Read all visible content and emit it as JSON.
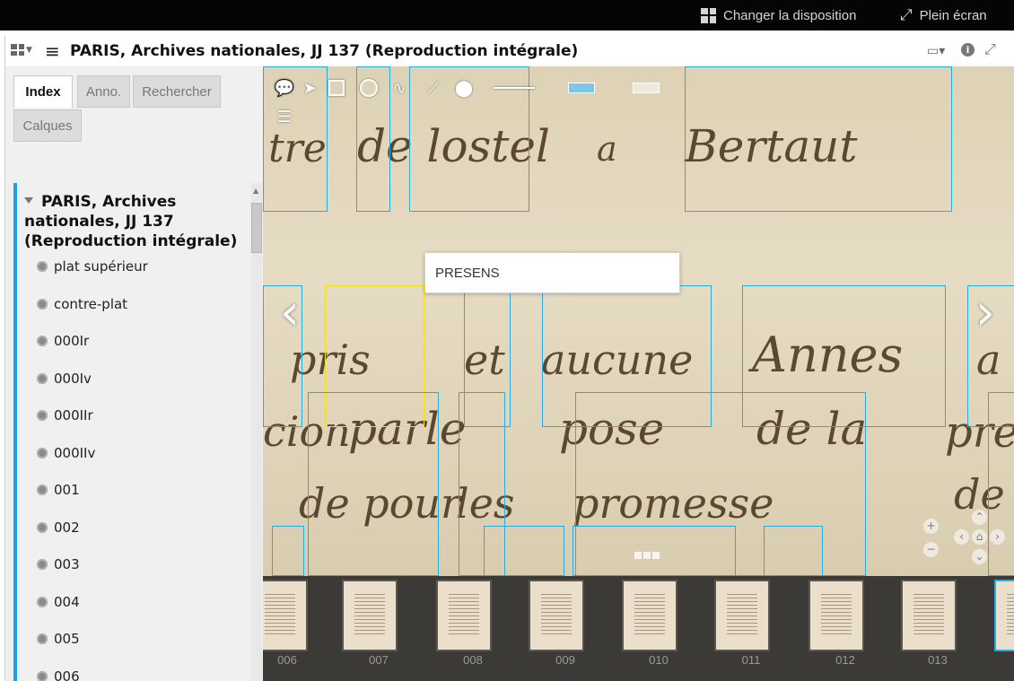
{
  "topbar": {
    "layout_label": "Changer la disposition",
    "fullscreen_label": "Plein écran"
  },
  "window": {
    "title": "PARIS, Archives nationales, JJ 137 (Reproduction intégrale)"
  },
  "sidebar": {
    "tabs": [
      {
        "label": "Index",
        "active": true
      },
      {
        "label": "Anno.",
        "active": false
      },
      {
        "label": "Rechercher",
        "active": false
      },
      {
        "label": "Calques",
        "active": false
      }
    ],
    "tree_root": "PARIS, Archives nationales, JJ 137 (Reproduction intégrale)",
    "items": [
      "plat supérieur",
      "contre-plat",
      "000Ir",
      "000Iv",
      "000IIr",
      "000IIv",
      "001",
      "002",
      "003",
      "004",
      "005",
      "006"
    ]
  },
  "viewer": {
    "tooltip_text": "PRESENS",
    "manuscript_words": [
      "tre",
      "de lostel",
      "a",
      "Bertaut",
      "pris",
      "et",
      "aucune",
      "Annes",
      "a",
      "cion",
      "parle",
      "pose",
      "de la",
      "pre",
      "de pour",
      "les",
      "promesse",
      "de la"
    ],
    "toolbar_icons": [
      "comment-icon",
      "pointer-icon",
      "rectangle-icon",
      "ellipse-icon",
      "freehand-icon",
      "polyline-icon",
      "pin-icon",
      "line-style-icon",
      "stroke-color-icon",
      "fill-color-icon",
      "settings-sliders-icon"
    ],
    "accent_color": "#2aaae3",
    "selected_color": "#f2e21c"
  },
  "filmstrip": {
    "labels": [
      "006",
      "007",
      "008",
      "009",
      "010",
      "011",
      "012",
      "013"
    ]
  }
}
